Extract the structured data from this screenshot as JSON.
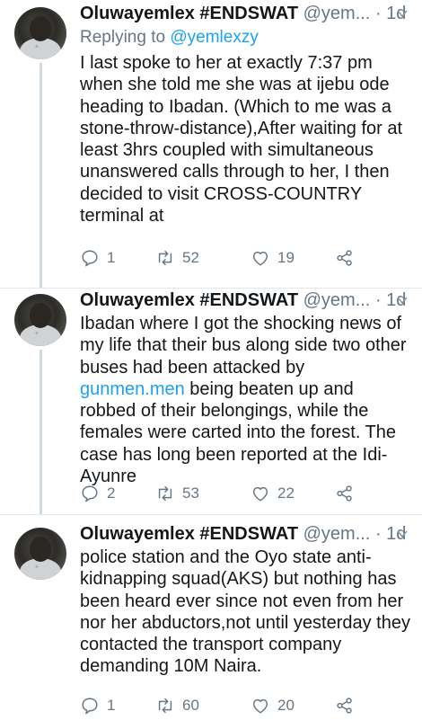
{
  "tweets": [
    {
      "author_name": "Oluwayemlex #ENDSWAT",
      "handle": "@yem...",
      "time": "1d",
      "reply_prefix": "Replying to",
      "reply_mention": "@yemlexzy",
      "text": "I last spoke to her at exactly 7:37 pm when she told me she was at ijebu ode heading to Ibadan. (Which to me was a stone-throw-distance),After waiting for at least 3hrs coupled with simultaneous unanswered calls through to her, I then decided to visit CROSS-COUNTRY terminal at",
      "replies": "1",
      "retweets": "52",
      "likes": "19"
    },
    {
      "author_name": "Oluwayemlex #ENDSWAT",
      "handle": "@yem...",
      "time": "1d",
      "text_before_link": "Ibadan where I got the shocking news of my life that their bus along side two other buses had been attacked by ",
      "link_text": "gunmen.men",
      "text_after_link": " being beaten up and robbed of their belongings, while the females were carted into the forest. The case has long been reported at the Idi-Ayunre",
      "replies": "2",
      "retweets": "53",
      "likes": "22"
    },
    {
      "author_name": "Oluwayemlex #ENDSWAT",
      "handle": "@yem...",
      "time": "1d",
      "text": "police station and the Oyo state anti-kidnapping squad(AKS) but nothing has been heard ever since not even from her nor her abductors,not until yesterday they contacted the transport company demanding 10M Naira.",
      "replies": "1",
      "retweets": "60",
      "likes": "20"
    }
  ],
  "colors": {
    "text": "#14171a",
    "secondary": "#657786",
    "link": "#1da1f2",
    "thread_line": "#cfd9de"
  }
}
